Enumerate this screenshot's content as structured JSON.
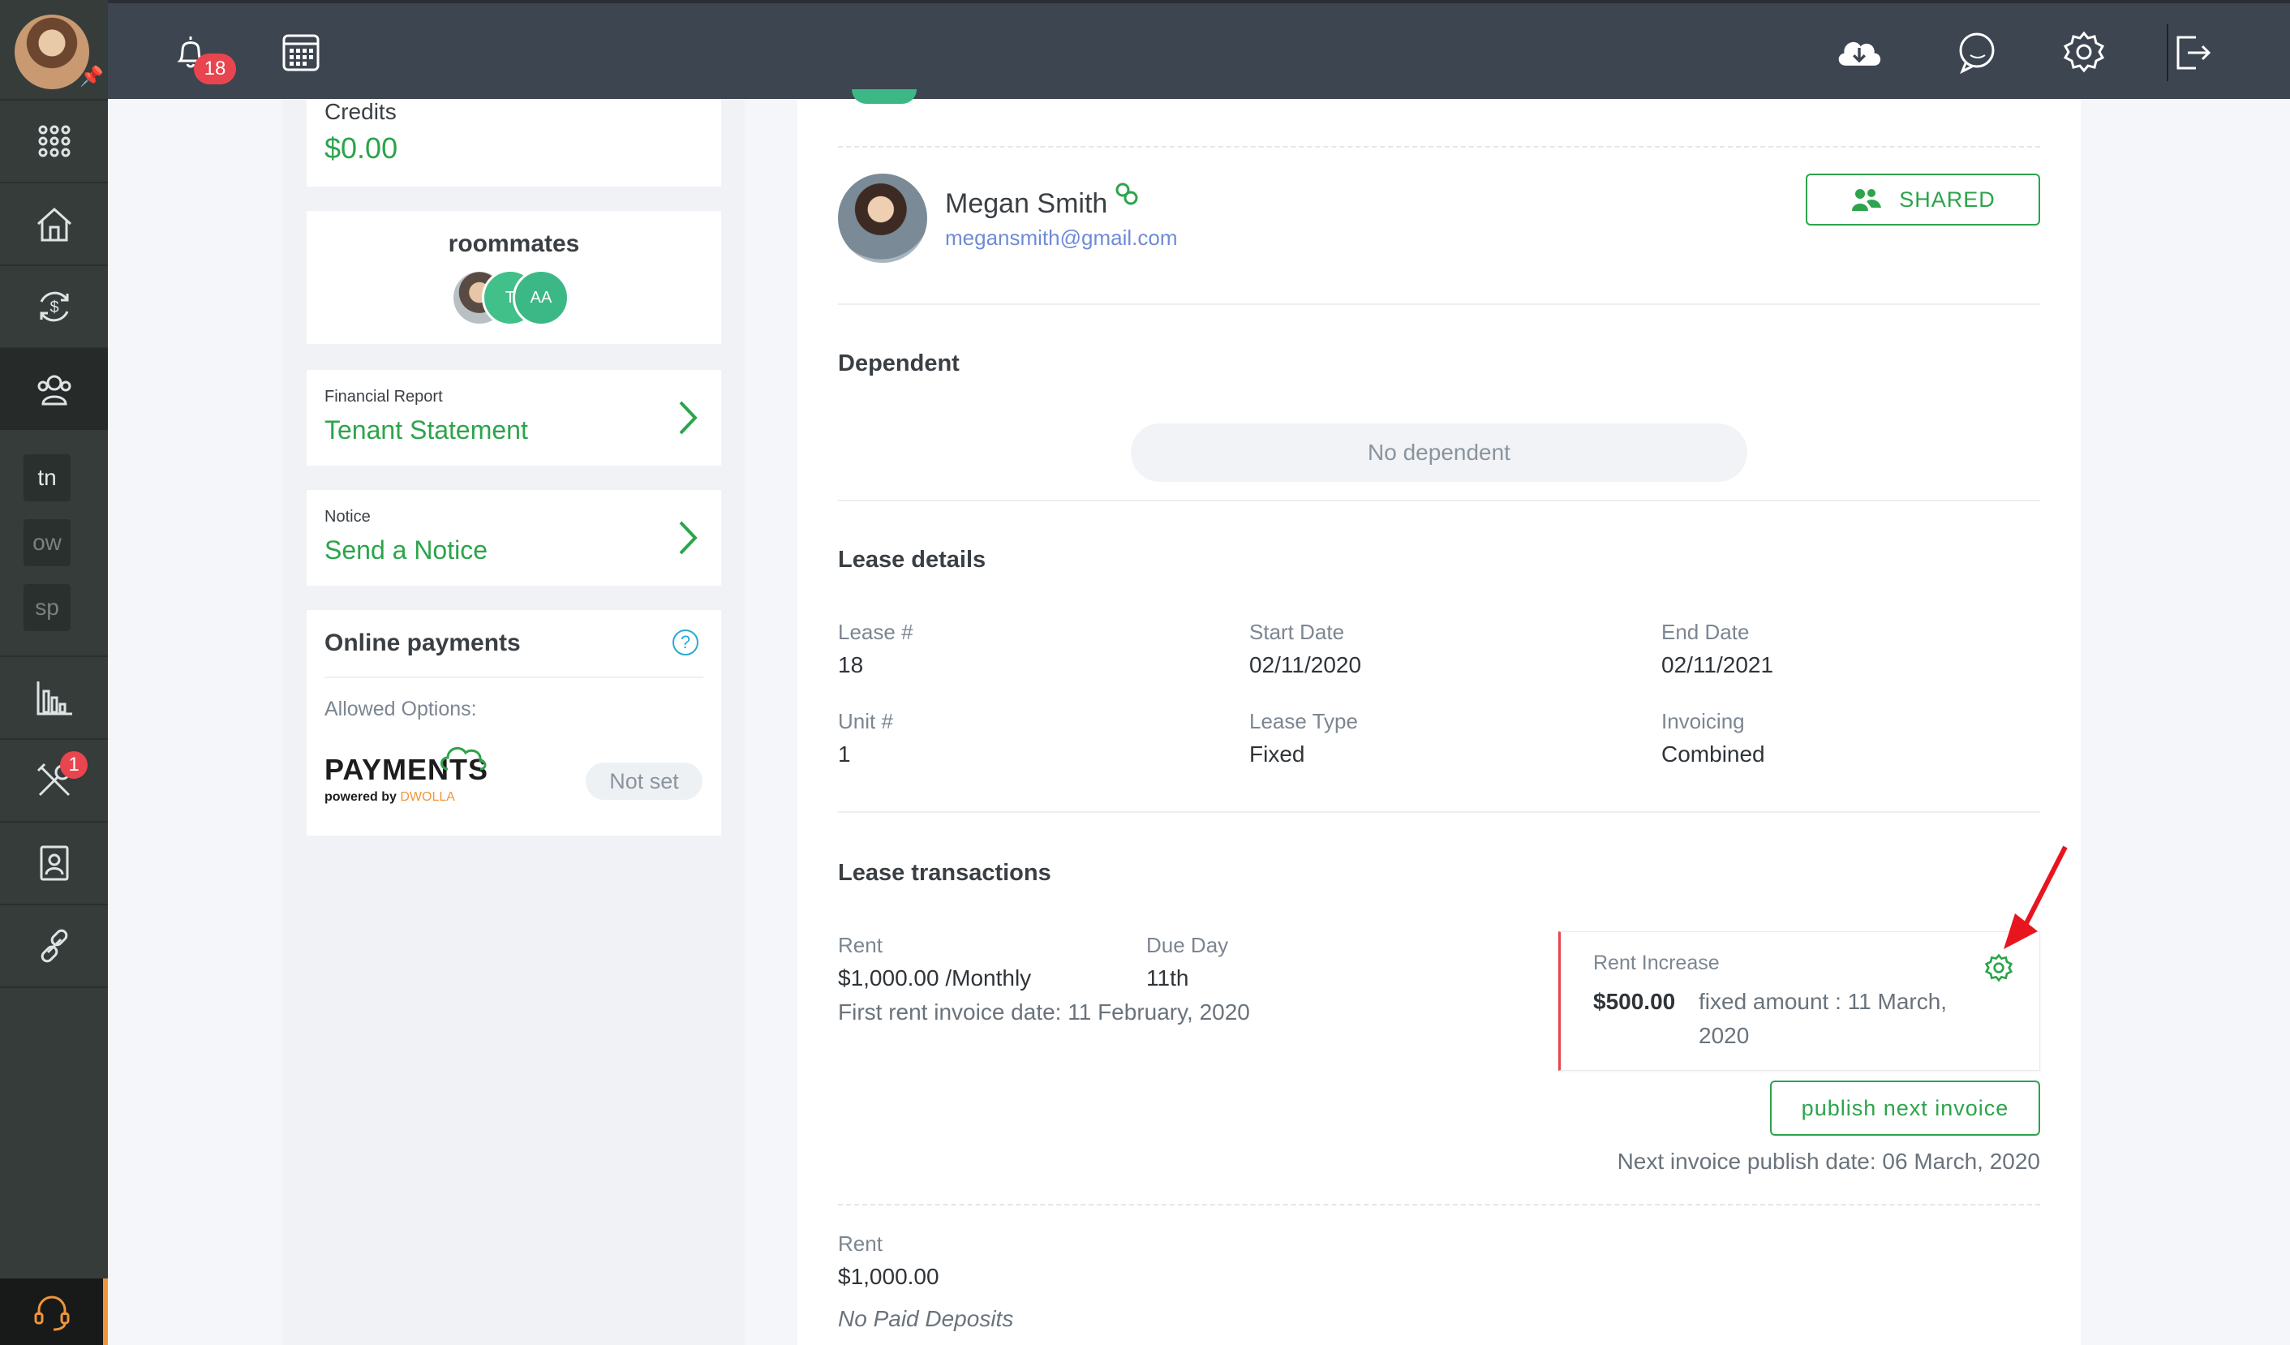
{
  "topbar": {
    "notification_count": "18",
    "icons": [
      "bell-icon",
      "calendar-icon",
      "cloud-download-icon",
      "chat-icon",
      "gear-icon",
      "logout-icon"
    ]
  },
  "sidebar": {
    "items": [
      "apps-grid-icon",
      "properties-icon",
      "payments-icon",
      "tenants-icon",
      "reports-icon",
      "maintenance-icon",
      "documents-icon",
      "integrations-icon"
    ],
    "tags": [
      "tn",
      "ow",
      "sp"
    ],
    "maintenance_badge": "1"
  },
  "left": {
    "credits_label": "Credits",
    "credits_value": "$0.00",
    "roommates_title": "roommates",
    "roommates": [
      "T",
      "AA"
    ],
    "financial_report_label": "Financial Report",
    "financial_report_link": "Tenant Statement",
    "notice_label": "Notice",
    "notice_link": "Send a Notice",
    "online_payments_title": "Online payments",
    "allowed_options_label": "Allowed Options:",
    "payments_logo": "PAYMENTS",
    "payments_powered": "powered by",
    "payments_dwolla": "DWOLLA",
    "not_set_badge": "Not set"
  },
  "tenant": {
    "name": "Megan Smith",
    "email": "megansmith@gmail.com",
    "shared_label": "SHARED"
  },
  "dependent": {
    "title": "Dependent",
    "empty_text": "No dependent"
  },
  "lease": {
    "title": "Lease details",
    "lease_no_label": "Lease #",
    "lease_no": "18",
    "start_label": "Start Date",
    "start": "02/11/2020",
    "end_label": "End Date",
    "end": "02/11/2021",
    "unit_label": "Unit #",
    "unit": "1",
    "type_label": "Lease Type",
    "type": "Fixed",
    "invoicing_label": "Invoicing",
    "invoicing": "Combined"
  },
  "transactions": {
    "title": "Lease transactions",
    "rent_label": "Rent",
    "rent_value": "$1,000.00 /Monthly",
    "due_label": "Due Day",
    "due_value": "11th",
    "first_invoice": "First rent invoice date: 11 February, 2020",
    "increase_label": "Rent Increase",
    "increase_amount": "$500.00",
    "increase_desc_1": "fixed amount : 11 March,",
    "increase_desc_2": "2020",
    "publish_button": "publish next invoice",
    "next_publish": "Next invoice publish date: 06 March, 2020",
    "deposit_label": "Rent",
    "deposit_value": "$1,000.00",
    "no_paid_deposits": "No Paid Deposits"
  },
  "colors": {
    "accent": "#2ca44b",
    "danger": "#e8454f",
    "topbar": "#3d4550",
    "sidebar": "#353c3a"
  }
}
